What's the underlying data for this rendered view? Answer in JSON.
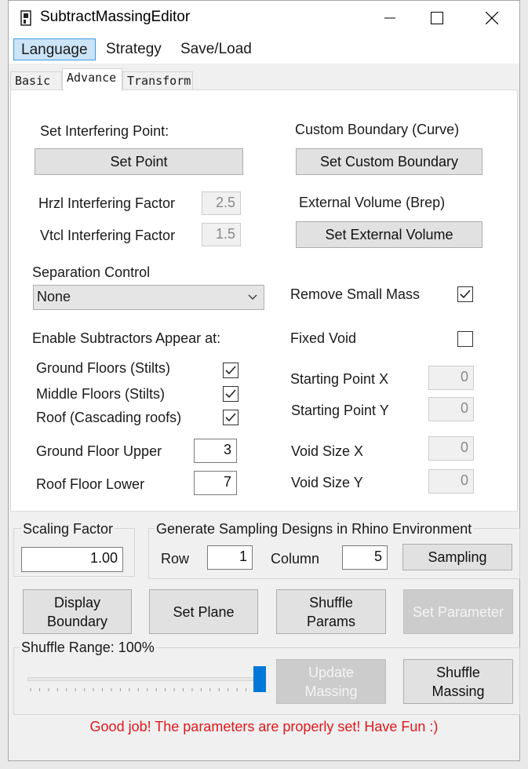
{
  "window": {
    "title": "SubtractMassingEditor"
  },
  "menu": {
    "items": [
      "Language",
      "Strategy",
      "Save/Load"
    ]
  },
  "tabs": [
    "Basic",
    "Advance",
    "Transform"
  ],
  "advance": {
    "interfering_point_label": "Set Interfering Point:",
    "set_point_button": "Set Point",
    "custom_boundary_label": "Custom Boundary (Curve)",
    "set_custom_boundary_button": "Set Custom Boundary",
    "hrzl_label": "Hrzl Interfering Factor",
    "hrzl_value": "2.5",
    "vtcl_label": "Vtcl Interfering Factor",
    "vtcl_value": "1.5",
    "external_volume_label": "External Volume (Brep)",
    "set_external_volume_button": "Set External Volume",
    "separation_label": "Separation Control",
    "separation_value": "None",
    "remove_small_mass_label": "Remove Small Mass",
    "remove_small_mass_checked": true,
    "enable_label": "Enable Subtractors Appear at:",
    "ground_floors_label": "Ground Floors (Stilts)",
    "ground_floors_checked": true,
    "middle_floors_label": "Middle Floors (Stilts)",
    "middle_floors_checked": true,
    "roof_label": "Roof (Cascading roofs)",
    "roof_checked": true,
    "ground_floor_upper_label": "Ground Floor Upper",
    "ground_floor_upper_value": "3",
    "roof_floor_lower_label": "Roof Floor Lower",
    "roof_floor_lower_value": "7",
    "fixed_void_label": "Fixed Void",
    "fixed_void_checked": false,
    "start_x_label": "Starting Point X",
    "start_x_value": "0",
    "start_y_label": "Starting Point Y",
    "start_y_value": "0",
    "void_x_label": "Void Size X",
    "void_x_value": "0",
    "void_y_label": "Void Size Y",
    "void_y_value": "0"
  },
  "bottom": {
    "scaling_label": "Scaling Factor",
    "scaling_value": "1.00",
    "sampling_group_label": "Generate Sampling Designs in Rhino Environment",
    "row_label": "Row",
    "row_value": "1",
    "column_label": "Column",
    "column_value": "5",
    "sampling_button": "Sampling",
    "display_boundary_button": [
      "Display",
      "Boundary"
    ],
    "set_plane_button": "Set Plane",
    "shuffle_params_button": [
      "Shuffle",
      "Params"
    ],
    "set_parameter_button": "Set Parameter",
    "shuffle_range_label": "Shuffle Range: 100%",
    "shuffle_range_value": 1.0,
    "update_massing_button": [
      "Update",
      "Massing"
    ],
    "shuffle_massing_button": [
      "Shuffle",
      "Massing"
    ]
  },
  "status_message": "Good job! The parameters are properly set! Have Fun :)",
  "colors": {
    "status": "#e0181d",
    "accent": "#0078d7",
    "menu_highlight": "#cce4f7"
  }
}
